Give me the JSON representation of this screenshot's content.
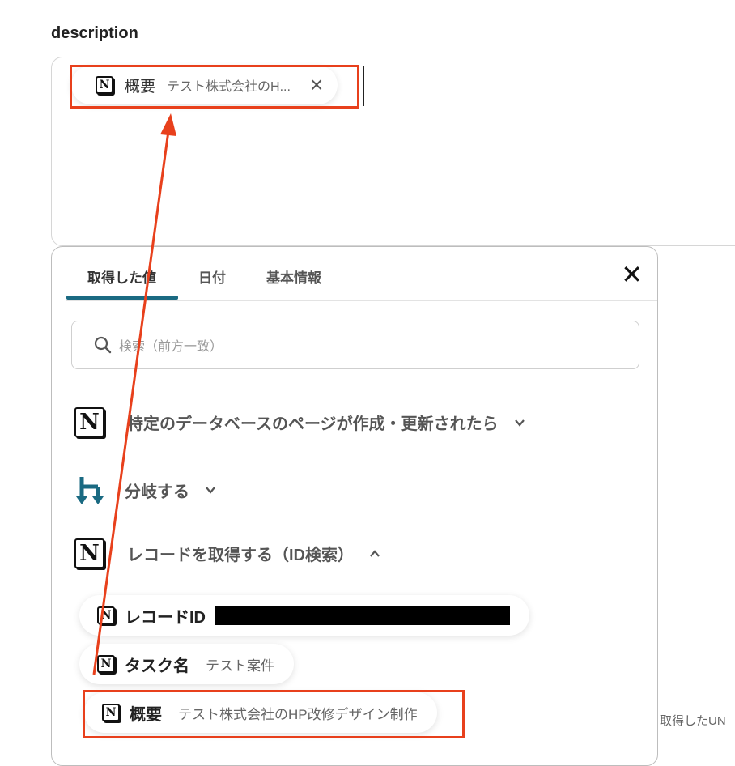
{
  "field": {
    "label": "description",
    "token": {
      "icon": "notion-icon",
      "label": "概要",
      "value": "テスト株式会社のH...",
      "close_icon": "close-icon"
    }
  },
  "panel": {
    "tabs": [
      {
        "label": "取得した値",
        "active": true
      },
      {
        "label": "日付",
        "active": false
      },
      {
        "label": "基本情報",
        "active": false
      }
    ],
    "close_icon": "close-icon",
    "search": {
      "placeholder": "検索（前方一致）",
      "icon": "search-icon"
    },
    "steps": [
      {
        "icon": "notion-icon",
        "label": "特定のデータベースのページが作成・更新されたら",
        "state": "collapsed"
      },
      {
        "icon": "branch-icon",
        "label": "分岐する",
        "state": "collapsed"
      },
      {
        "icon": "notion-icon",
        "label": "レコードを取得する（ID検索）",
        "state": "expanded"
      }
    ],
    "records": [
      {
        "label": "レコードID",
        "value": "",
        "redacted": true
      },
      {
        "label": "タスク名",
        "value": "テスト案件"
      },
      {
        "label": "概要",
        "value": "テスト株式会社のHP改修デザイン制作"
      }
    ]
  },
  "side_text": "取得したUN",
  "colors": {
    "accent": "#1a6a82",
    "highlight": "#e8401c",
    "branch": "#1a6a82"
  }
}
